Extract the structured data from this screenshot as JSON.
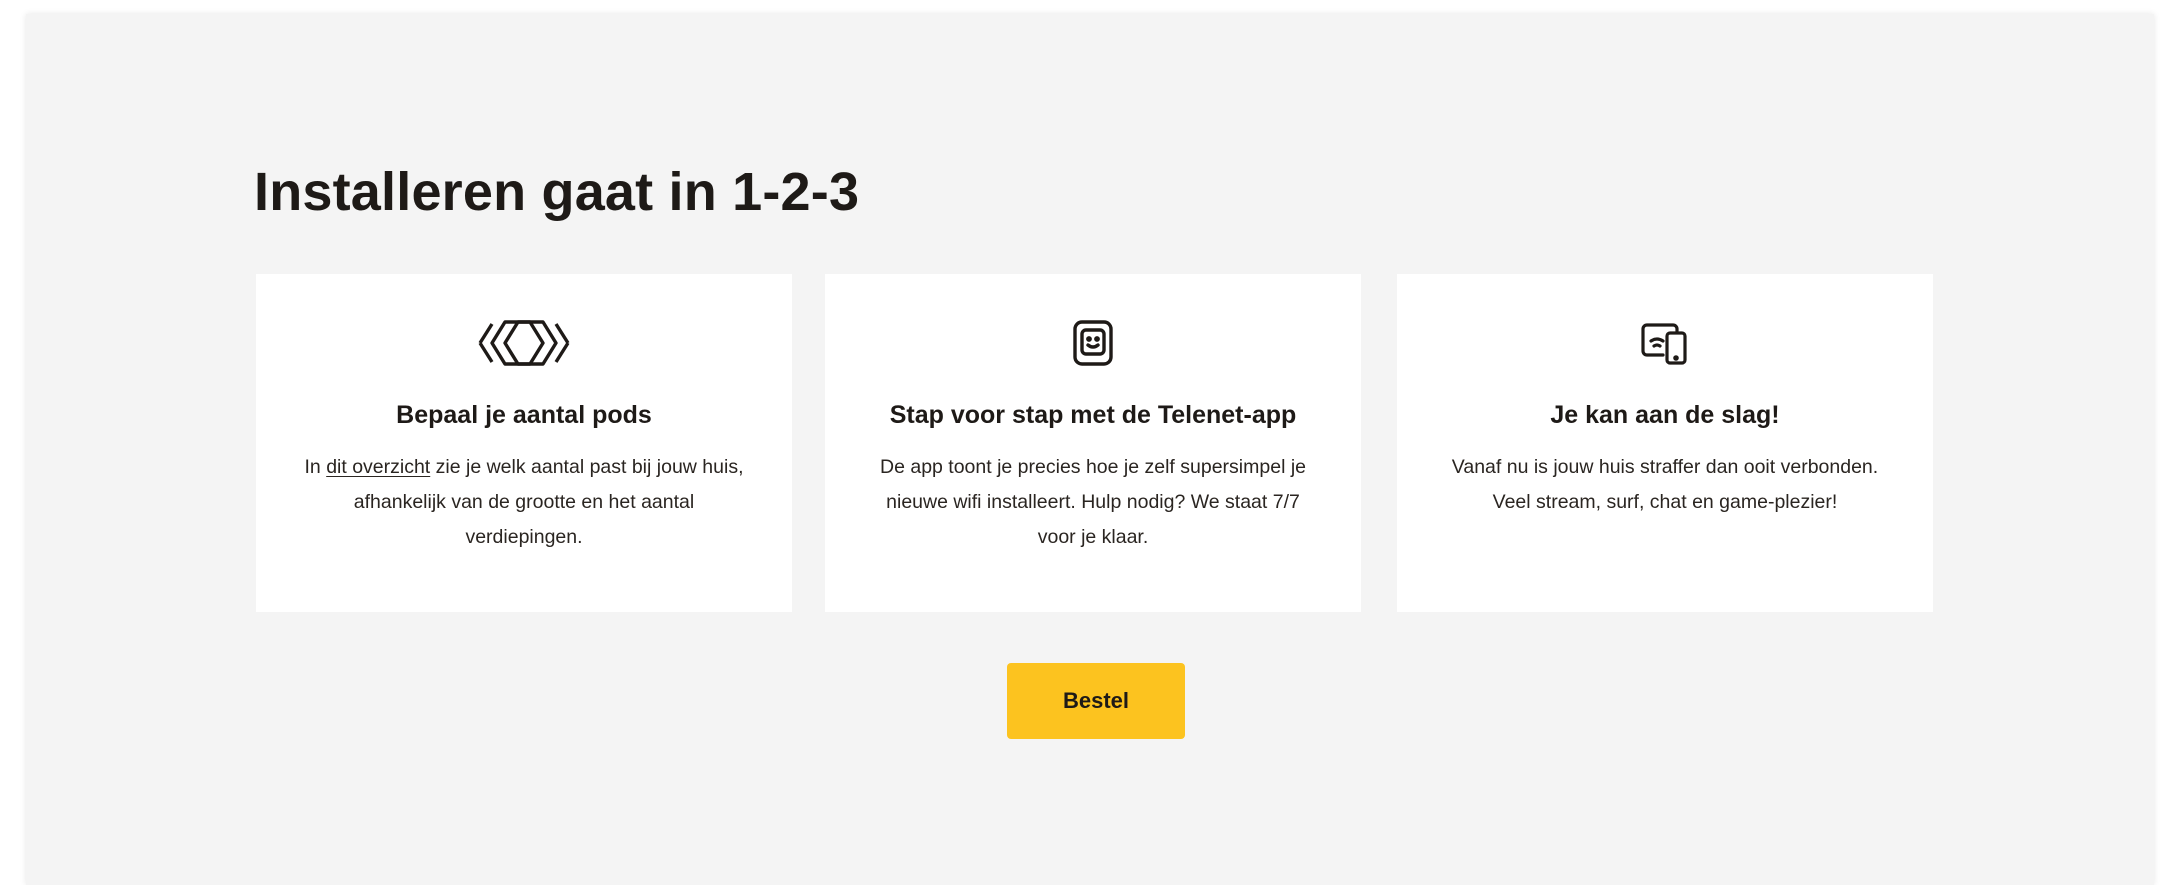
{
  "section": {
    "title": "Installeren gaat in 1-2-3"
  },
  "steps": [
    {
      "icon": "pods-icon",
      "title": "Bepaal je aantal pods",
      "text_before_link": "In ",
      "link_text": "dit overzicht",
      "text_after_link": " zie je welk aantal past bij jouw huis, afhankelijk van de grootte en het aantal verdiepingen."
    },
    {
      "icon": "telenet-app-icon",
      "title": "Stap voor stap met de Telenet-app",
      "text": "De app toont je precies hoe je zelf supersimpel je nieuwe wifi installeert. Hulp nodig? We staat 7/7 voor je klaar."
    },
    {
      "icon": "devices-wifi-icon",
      "title": "Je kan aan de slag!",
      "text": "Vanaf nu is jouw huis straffer dan ooit verbonden. Veel stream, surf, chat en game-plezier!"
    }
  ],
  "cta": {
    "label": "Bestel",
    "color": "#fcc31f"
  },
  "colors": {
    "background": "#f4f4f4",
    "card": "#ffffff",
    "text": "#1e1a17",
    "accent": "#fcc31f"
  }
}
